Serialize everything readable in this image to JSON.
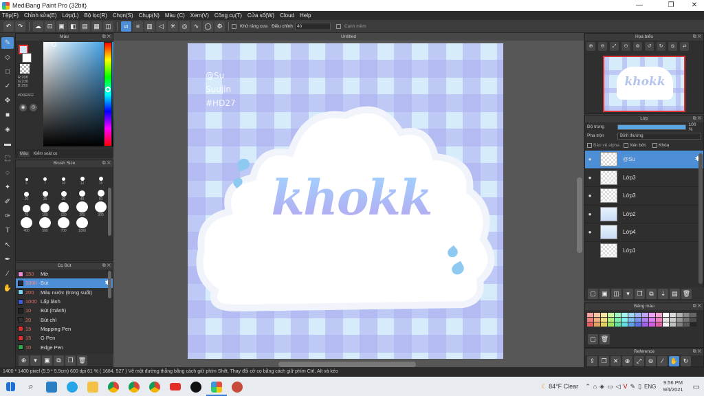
{
  "window": {
    "title": "MediBang Paint Pro (32bit)",
    "controls": [
      "—",
      "❐",
      "✕"
    ]
  },
  "menu": [
    "Tệp(F)",
    "Chỉnh sửa(E)",
    "Lớp(L)",
    "Bộ lọc(R)",
    "Chọn(S)",
    "Chụp(N)",
    "Màu (C)",
    "Xem(V)",
    "Công cụ(T)",
    "Cửa sổ(W)",
    "Cloud",
    "Help"
  ],
  "toolbar": {
    "antialias_label": "Khử răng cưa",
    "adjust_label": "Điều chỉnh",
    "adjust_value": "40",
    "canh_mem_label": "Cạnh mềm"
  },
  "color_panel": {
    "title": "Màu",
    "r": "R:208",
    "g": "G:230",
    "b": "B:255",
    "hex": "#D0E6FF",
    "tabs": [
      "Màu",
      "Kiểm soát cọ"
    ],
    "fg_color": "#D0E6FF"
  },
  "brush_size_panel": {
    "title": "Brush Size",
    "sizes": [
      "5",
      "7",
      "10",
      "12",
      "15",
      "20",
      "25",
      "30",
      "40",
      "50",
      "70",
      "100",
      "150",
      "200",
      "300",
      "400",
      "500",
      "700",
      "1000"
    ]
  },
  "brush_panel": {
    "title": "Cọ Bút",
    "items": [
      {
        "size": "150",
        "name": "Mờ",
        "color": "#f28ad8"
      },
      {
        "size": "1000",
        "name": "Bút",
        "color": "#1e2a3a"
      },
      {
        "size": "200",
        "name": "Màu nước (trong suốt)",
        "color": "#7ad3f0"
      },
      {
        "size": "1000",
        "name": "Lấp lánh",
        "color": "#3b5bd9"
      },
      {
        "size": "10",
        "name": "Bút (mảnh)",
        "color": "#222222"
      },
      {
        "size": "20",
        "name": "Bút chì",
        "color": "#333333"
      },
      {
        "size": "15",
        "name": "Mapping Pen",
        "color": "#e03030"
      },
      {
        "size": "15",
        "name": "G Pen",
        "color": "#e03030"
      },
      {
        "size": "10",
        "name": "Edge Pen",
        "color": "#2aa84a"
      }
    ]
  },
  "document": {
    "tab_title": "Untitled",
    "signature_lines": [
      "@Su",
      "Suujin",
      "#HD27"
    ],
    "artwork_text": "khokk"
  },
  "navigator": {
    "title": "Họa biểu",
    "thumb_text": "khokk"
  },
  "layers_panel": {
    "title": "Lớp",
    "opacity_label": "Độ trong",
    "opacity_value": "100 %",
    "opacity_percent": 100,
    "blend_label": "Pha trộn",
    "blend_value": "Bình thường",
    "protect_alpha": "Bảo vệ alpha",
    "clipping": "Xén bớt",
    "lock": "Khóa",
    "layers": [
      {
        "name": "@Su",
        "selected": true
      },
      {
        "name": "Lớp3",
        "selected": false
      },
      {
        "name": "Lớp3",
        "selected": false
      },
      {
        "name": "Lớp2",
        "selected": false
      },
      {
        "name": "Lớp4",
        "selected": false
      },
      {
        "name": "Lớp1",
        "selected": false
      }
    ]
  },
  "palette_panel": {
    "title": "Bảng màu",
    "colors": [
      "#f5a3a3",
      "#f5c6a3",
      "#f5e6a3",
      "#c6f5a3",
      "#a3f5c1",
      "#a3f5ee",
      "#a3d4f5",
      "#a3b3f5",
      "#c3a3f5",
      "#eaa3f5",
      "#f5a3cf",
      "#ffffff",
      "#d9d9d9",
      "#b3b3b3",
      "#8c8c8c",
      "#666666",
      "#f08080",
      "#f0b080",
      "#f0e080",
      "#b0f080",
      "#80f0b0",
      "#80f0f0",
      "#80c0f0",
      "#8090f0",
      "#b080f0",
      "#e080f0",
      "#f080c0",
      "#e6e6e6",
      "#cccccc",
      "#999999",
      "#737373",
      "#4d4d4d",
      "#e06060",
      "#e0a060",
      "#e0d060",
      "#a0e060",
      "#60e0a0",
      "#60e0e0",
      "#60a0e0",
      "#6070e0",
      "#a060e0",
      "#d060e0",
      "#e060a0",
      "#f2f2f2",
      "#bfbfbf",
      "#808080",
      "#595959",
      "#262626"
    ]
  },
  "reference_panel": {
    "title": "Reference"
  },
  "status_bar": {
    "text": "1400 * 1400 pixel   (5.9 * 5.9cm)   600 dpi   61 %   ( 1684, 527 )   Vẽ một đường thẳng bằng cách giữ phím Shift, Thay đổi cỡ cọ bằng cách giữ phím Ctrl, Alt và kéo"
  },
  "taskbar": {
    "weather": "84°F  Clear",
    "lang": "ENG",
    "time": "9:56 PM",
    "date": "9/4/2021"
  }
}
